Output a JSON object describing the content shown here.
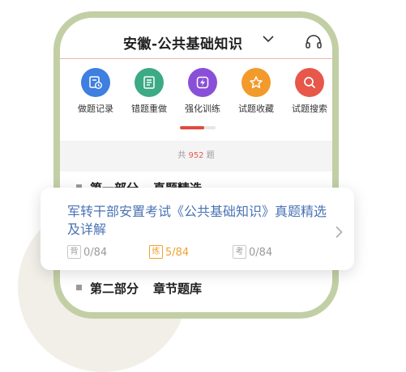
{
  "header": {
    "title": "安徽-公共基础知识"
  },
  "tools": [
    {
      "label": "做题记录",
      "icon": "history-icon",
      "color": "#3e7fe0"
    },
    {
      "label": "错题重做",
      "icon": "notebook-icon",
      "color": "#3caa84"
    },
    {
      "label": "强化训练",
      "icon": "lightning-icon",
      "color": "#8a4fd8"
    },
    {
      "label": "试题收藏",
      "icon": "star-icon",
      "color": "#f29a2c"
    },
    {
      "label": "试题搜索",
      "icon": "search-icon",
      "color": "#e7574a"
    }
  ],
  "summary": {
    "prefix": "共",
    "count": "952",
    "suffix": "题"
  },
  "sections": [
    {
      "part": "第一部分",
      "name": "真题精选"
    },
    {
      "part": "第二部分",
      "name": "章节题库"
    }
  ],
  "card": {
    "title": "军转干部安置考试《公共基础知识》真题精选及详解",
    "stats": [
      {
        "badge": "背",
        "value": "0/84"
      },
      {
        "badge": "练",
        "value": "5/84"
      },
      {
        "badge": "考",
        "value": "0/84"
      }
    ]
  },
  "colors": {
    "frame": "#c2cfa5",
    "accent": "#e04b3c",
    "card_title": "#4a73b5",
    "active_stat": "#f0a030"
  }
}
